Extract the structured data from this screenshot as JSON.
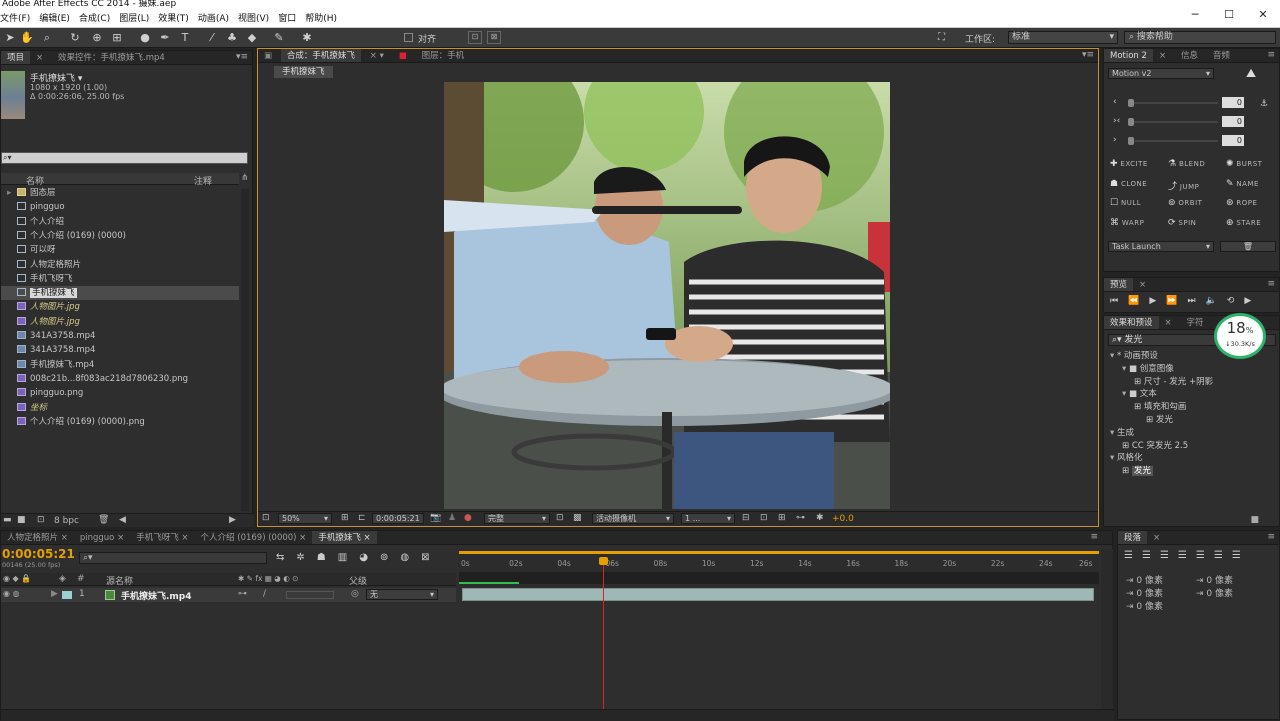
{
  "app": {
    "title": "Adobe After Effects CC 2014 - 摄妹.aep"
  },
  "menu": [
    "文件(F)",
    "编辑(E)",
    "合成(C)",
    "图层(L)",
    "效果(T)",
    "动画(A)",
    "视图(V)",
    "窗口",
    "帮助(H)"
  ],
  "toolbar": {
    "align_label": "对齐",
    "workspace_label": "工作区:",
    "workspace_value": "标准",
    "search_placeholder": "搜索帮助"
  },
  "project": {
    "tabs": [
      "项目",
      "效果控件：手机撩妹飞.mp4"
    ],
    "selected": {
      "name": "手机撩妹飞 ▾",
      "size": "1080 x 1920 (1.00)",
      "duration": "Δ 0:00:26:06, 25.00 fps"
    },
    "col_name": "名称",
    "col_comment": "注释",
    "items": [
      {
        "name": "固态层",
        "kind": "folder"
      },
      {
        "name": "pingguo",
        "kind": "comp"
      },
      {
        "name": "个人介绍",
        "kind": "comp"
      },
      {
        "name": "个人介绍 (0169) (0000)",
        "kind": "comp"
      },
      {
        "name": "可以呀",
        "kind": "comp"
      },
      {
        "name": "人物定格照片",
        "kind": "comp"
      },
      {
        "name": "手机飞呀飞",
        "kind": "comp"
      },
      {
        "name": "手机撩妹飞",
        "kind": "comp",
        "selected": true
      },
      {
        "name": "人物图片.jpg",
        "kind": "img",
        "italic": true
      },
      {
        "name": "人物图片.jpg",
        "kind": "img",
        "italic": true
      },
      {
        "name": "341A3758.mp4",
        "kind": "vid"
      },
      {
        "name": "341A3758.mp4",
        "kind": "vid"
      },
      {
        "name": "手机撩妹飞.mp4",
        "kind": "vid"
      },
      {
        "name": "008c21b...8f083ac218d7806230.png",
        "kind": "img"
      },
      {
        "name": "pingguo.png",
        "kind": "img"
      },
      {
        "name": "坐标",
        "kind": "img",
        "italic": true
      },
      {
        "name": "个人介绍 (0169) (0000).png",
        "kind": "img"
      }
    ],
    "bpc": "8 bpc"
  },
  "comp_viewer": {
    "tabs": [
      "合成：手机撩妹飞",
      "图层：手机"
    ],
    "breadcrumb": "手机撩妹飞",
    "zoom": "50%",
    "timecode": "0:00:05:21",
    "quality": "完整",
    "camera": "活动摄像机",
    "views": "1 ...",
    "exposure": "+0.0"
  },
  "motion": {
    "tabs": [
      "Motion 2",
      "信息",
      "音频"
    ],
    "dropdown": "Motion v2",
    "values": [
      "0",
      "0",
      "0"
    ],
    "buttons": [
      "EXCITE",
      "BLEND",
      "BURST",
      "CLONE",
      "JUMP",
      "NAME",
      "NULL",
      "ORBIT",
      "ROPE",
      "WARP",
      "SPIN",
      "STARE"
    ],
    "task": "Task Launch"
  },
  "preview": {
    "tab": "预览"
  },
  "effects": {
    "tabs": [
      "效果和预设",
      "字符"
    ],
    "search": "发光",
    "tree": [
      {
        "label": "* 动画预设",
        "level": 0
      },
      {
        "label": "创意图像",
        "level": 1
      },
      {
        "label": "尺寸 - 发光 +阴影",
        "level": 2
      },
      {
        "label": "文本",
        "level": 1
      },
      {
        "label": "填充和勾画",
        "level": 2
      },
      {
        "label": "发光",
        "level": 3
      },
      {
        "label": "生成",
        "level": 0
      },
      {
        "label": "CC 突发光 2.5",
        "level": 1
      },
      {
        "label": "风格化",
        "level": 0
      },
      {
        "label": "发光",
        "level": 1,
        "selected": true
      }
    ]
  },
  "netmeter": {
    "percent": "18",
    "unit": "%",
    "speed": "↓30.3K/s"
  },
  "timeline": {
    "tabs": [
      "人物定格照片",
      "pingguo",
      "手机飞呀飞",
      "个人介绍 (0169) (0000)",
      "手机撩妹飞"
    ],
    "timecode": "0:00:05:21",
    "fps_info": "00146 (25.00 fps)",
    "col_source": "源名称",
    "col_parent": "父级",
    "layer": {
      "index": "1",
      "name": "手机撩妹飞.mp4",
      "parent": "无"
    },
    "ticks": [
      "0s",
      "02s",
      "04s",
      "06s",
      "08s",
      "10s",
      "12s",
      "14s",
      "16s",
      "18s",
      "20s",
      "22s",
      "24s",
      "26s"
    ],
    "playhead_time_s": 5.84,
    "duration_s": 26.24
  },
  "paragraph": {
    "tab": "段落",
    "px_labels": [
      "0 像素",
      "0 像素",
      "0 像素",
      "0 像素",
      "0 像素"
    ]
  }
}
